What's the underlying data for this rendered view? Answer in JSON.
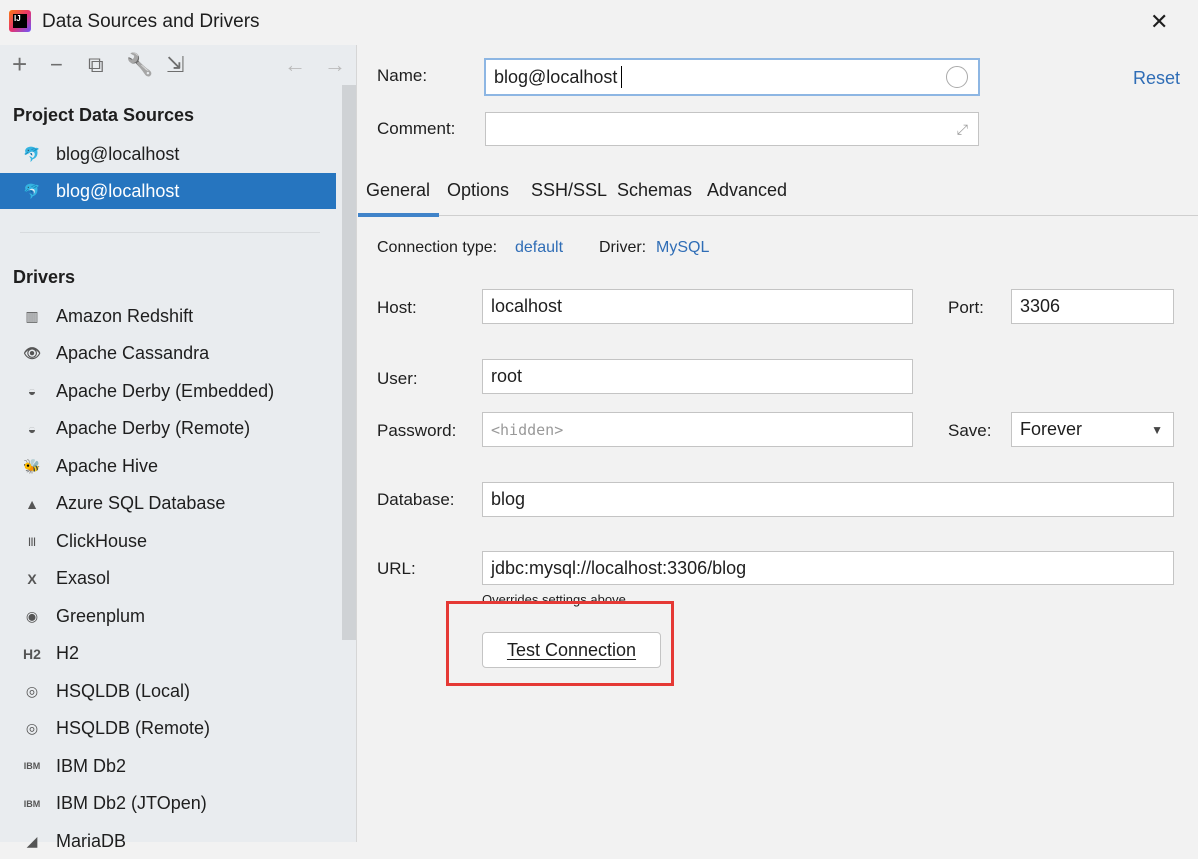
{
  "window": {
    "title": "Data Sources and Drivers",
    "close": "✕"
  },
  "toolbar": {
    "add": "+",
    "remove": "−",
    "duplicate": "⧉",
    "properties": "🔧",
    "import": "⇲",
    "back": "←",
    "forward": "→"
  },
  "sidebar": {
    "project_title": "Project Data Sources",
    "sources": [
      {
        "label": "blog@localhost",
        "selected": false
      },
      {
        "label": "blog@localhost",
        "selected": true
      }
    ],
    "drivers_title": "Drivers",
    "drivers": [
      {
        "label": "Amazon Redshift",
        "icon": "▥"
      },
      {
        "label": "Apache Cassandra",
        "icon": "👁"
      },
      {
        "label": "Apache Derby (Embedded)",
        "icon": "◒"
      },
      {
        "label": "Apache Derby (Remote)",
        "icon": "◒"
      },
      {
        "label": "Apache Hive",
        "icon": "🐝"
      },
      {
        "label": "Azure SQL Database",
        "icon": "▲"
      },
      {
        "label": "ClickHouse",
        "icon": "|||"
      },
      {
        "label": "Exasol",
        "icon": "X"
      },
      {
        "label": "Greenplum",
        "icon": "◉"
      },
      {
        "label": "H2",
        "icon": "H2"
      },
      {
        "label": "HSQLDB (Local)",
        "icon": "◎"
      },
      {
        "label": "HSQLDB (Remote)",
        "icon": "◎"
      },
      {
        "label": "IBM Db2",
        "icon": "IBM"
      },
      {
        "label": "IBM Db2 (JTOpen)",
        "icon": "IBM"
      },
      {
        "label": "MariaDB",
        "icon": "◢"
      }
    ]
  },
  "form": {
    "name_label": "Name:",
    "name_value": "blog@localhost",
    "comment_label": "Comment:",
    "comment_value": "",
    "reset": "Reset",
    "tabs": [
      "General",
      "Options",
      "SSH/SSL",
      "Schemas",
      "Advanced"
    ],
    "active_tab": "General",
    "connection_type_label": "Connection type:",
    "connection_type": "default",
    "driver_label": "Driver:",
    "driver": "MySQL",
    "host_label": "Host:",
    "host": "localhost",
    "port_label": "Port:",
    "port": "3306",
    "user_label": "User:",
    "user": "root",
    "password_label": "Password:",
    "password_placeholder": "<hidden>",
    "save_label": "Save:",
    "save_value": "Forever",
    "database_label": "Database:",
    "database": "blog",
    "url_label": "URL:",
    "url": "jdbc:mysql://localhost:3306/blog",
    "url_hint": "Overrides settings above",
    "test_connection": "Test Connection",
    "highlight_color": "#e53935"
  }
}
